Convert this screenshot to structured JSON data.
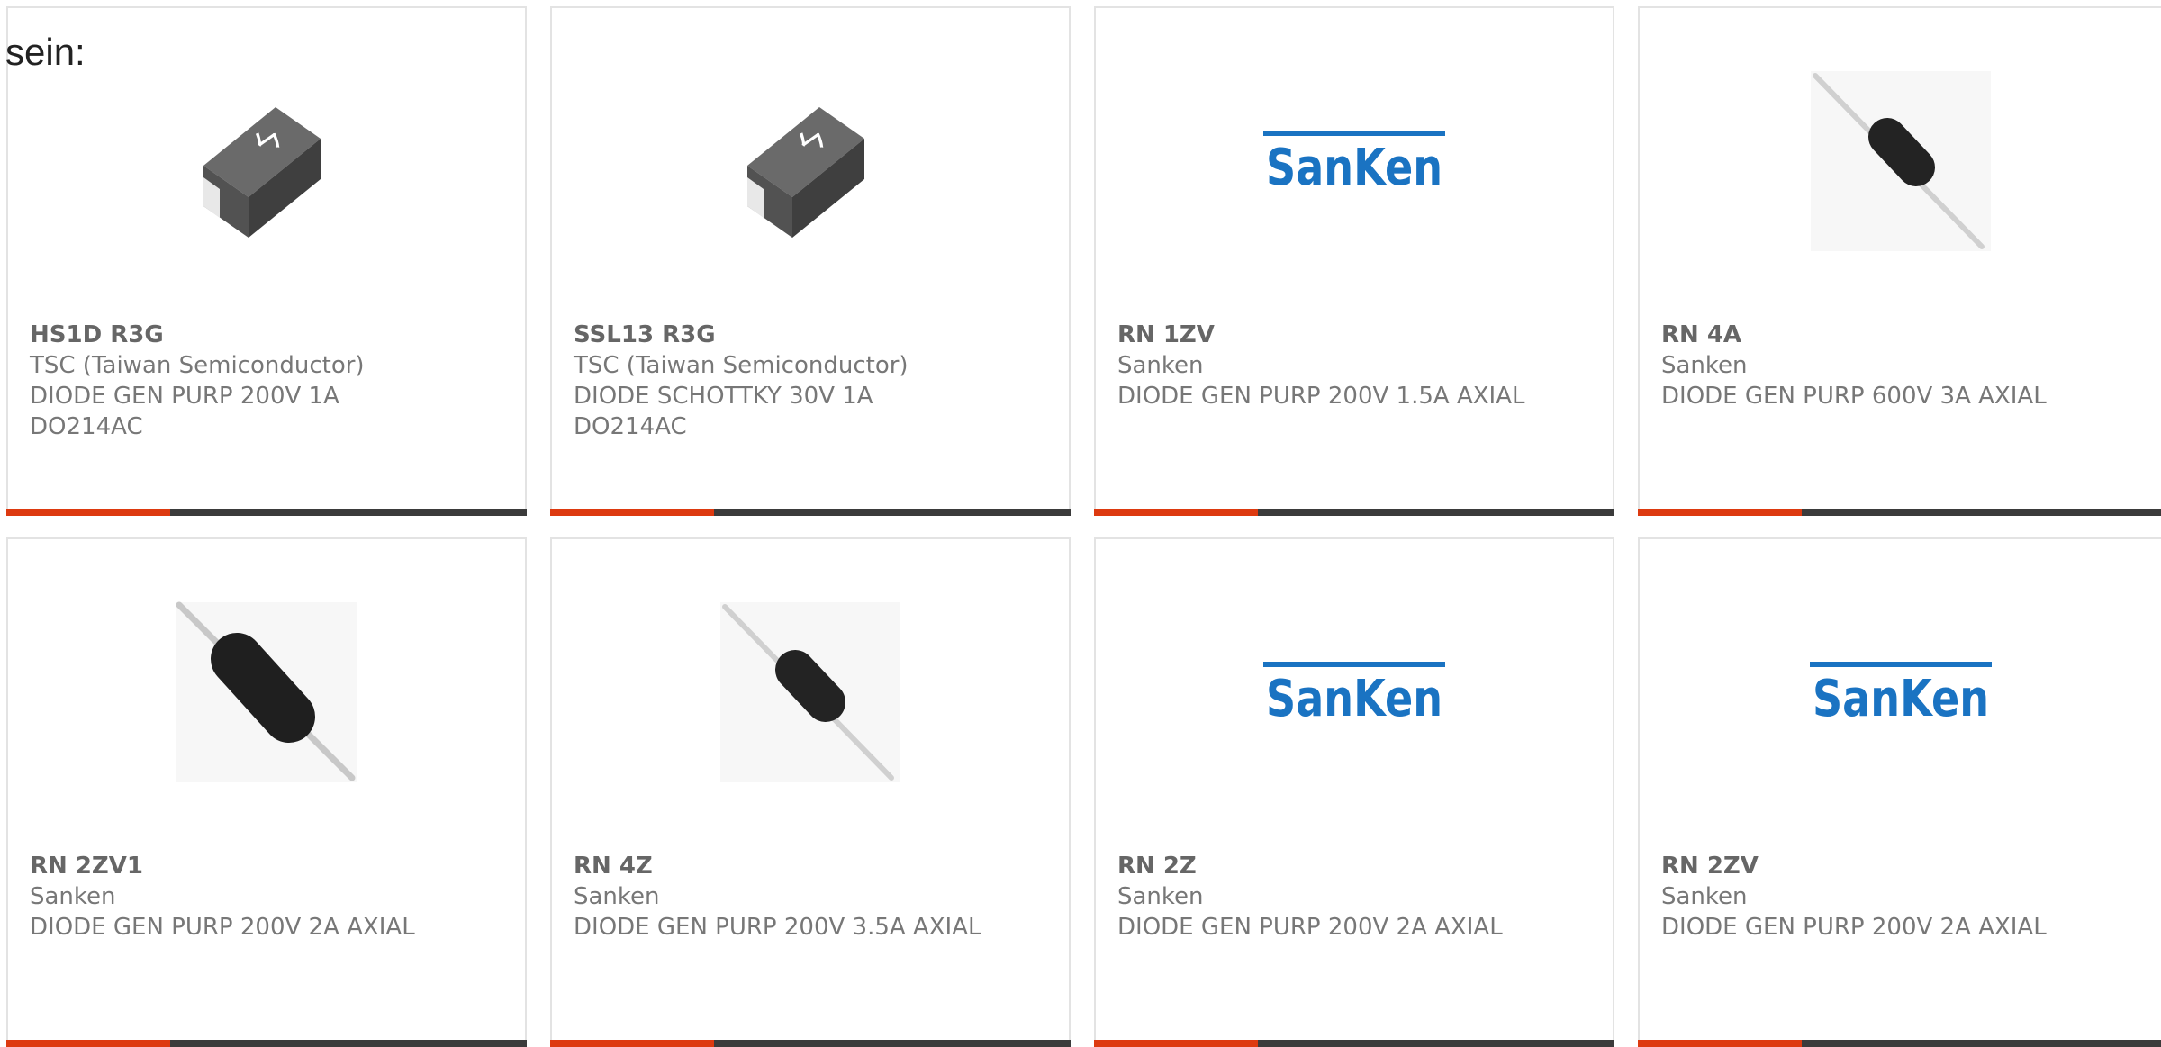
{
  "page": {
    "intro_text": "sein:"
  },
  "colors": {
    "accent": "#dd3a10",
    "bar": "#3b3b3b",
    "sanken_blue": "#1a73c2",
    "card_border": "#e3e3e3"
  },
  "products": [
    {
      "part_number": "HS1D R3G",
      "manufacturer": "TSC (Taiwan Semiconductor)",
      "description": "DIODE GEN PURP 200V 1A DO214AC",
      "image": "smd-diode-icon"
    },
    {
      "part_number": "SSL13 R3G",
      "manufacturer": "TSC (Taiwan Semiconductor)",
      "description": "DIODE SCHOTTKY 30V 1A DO214AC",
      "image": "smd-diode-icon"
    },
    {
      "part_number": "RN 1ZV",
      "manufacturer": "Sanken",
      "description": "DIODE GEN PURP 200V 1.5A AXIAL",
      "image": "sanken-logo"
    },
    {
      "part_number": "RN 4A",
      "manufacturer": "Sanken",
      "description": "DIODE GEN PURP 600V 3A AXIAL",
      "image": "axial-diode-icon"
    },
    {
      "part_number": "RN 2ZV1",
      "manufacturer": "Sanken",
      "description": "DIODE GEN PURP 200V 2A AXIAL",
      "image": "axial-diode-icon"
    },
    {
      "part_number": "RN 4Z",
      "manufacturer": "Sanken",
      "description": "DIODE GEN PURP 200V 3.5A AXIAL",
      "image": "axial-diode-icon"
    },
    {
      "part_number": "RN 2Z",
      "manufacturer": "Sanken",
      "description": "DIODE GEN PURP 200V 2A AXIAL",
      "image": "sanken-logo"
    },
    {
      "part_number": "RN 2ZV",
      "manufacturer": "Sanken",
      "description": "DIODE GEN PURP 200V 2A AXIAL",
      "image": "sanken-logo"
    }
  ]
}
